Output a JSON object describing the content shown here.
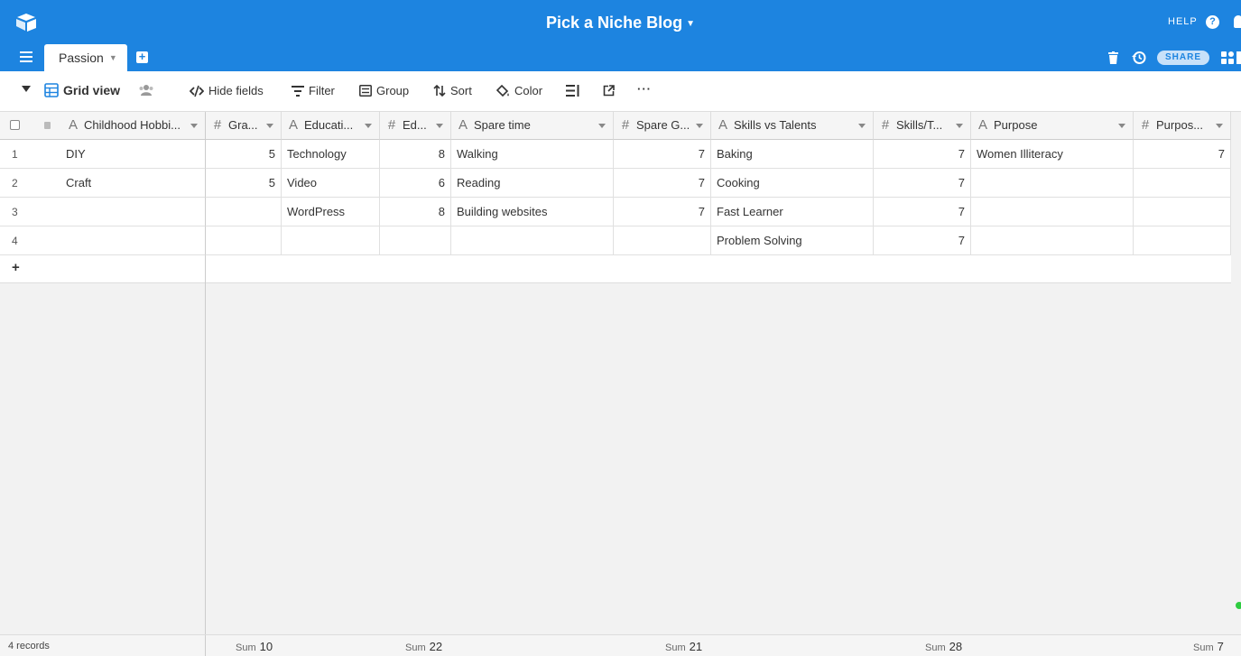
{
  "header": {
    "base_title": "Pick a Niche Blog",
    "help_label": "HELP",
    "share_label": "SHARE",
    "accent_color": "#1d84e0"
  },
  "tabs": [
    {
      "label": "Passion"
    }
  ],
  "toolbar": {
    "view_name": "Grid view",
    "hide_fields": "Hide fields",
    "filter": "Filter",
    "group": "Group",
    "sort": "Sort",
    "color": "Color",
    "more": "···"
  },
  "columns": [
    {
      "label": "Childhood Hobbi...",
      "type": "text"
    },
    {
      "label": "Gra...",
      "type": "number"
    },
    {
      "label": "Educati...",
      "type": "text"
    },
    {
      "label": "Ed...",
      "type": "number"
    },
    {
      "label": "Spare time",
      "type": "text"
    },
    {
      "label": "Spare G...",
      "type": "number"
    },
    {
      "label": "Skills vs Talents",
      "type": "text"
    },
    {
      "label": "Skills/T...",
      "type": "number"
    },
    {
      "label": "Purpose",
      "type": "text"
    },
    {
      "label": "Purpos...",
      "type": "number"
    }
  ],
  "rows": [
    {
      "num": "1",
      "cells": [
        "DIY",
        "5",
        "Technology",
        "8",
        "Walking",
        "7",
        "Baking",
        "7",
        "Women Illiteracy",
        "7"
      ]
    },
    {
      "num": "2",
      "cells": [
        "Craft",
        "5",
        "Video",
        "6",
        "Reading",
        "7",
        "Cooking",
        "7",
        "",
        ""
      ]
    },
    {
      "num": "3",
      "cells": [
        "",
        "",
        "WordPress",
        "8",
        "Building websites",
        "7",
        "Fast Learner",
        "7",
        "",
        ""
      ]
    },
    {
      "num": "4",
      "cells": [
        "",
        "",
        "",
        "",
        "",
        "",
        "Problem Solving",
        "7",
        "",
        ""
      ]
    }
  ],
  "add_row_label": "+",
  "footer": {
    "records": "4 records",
    "sum_label": "Sum",
    "sums": [
      "10",
      "22",
      "21",
      "28",
      "7"
    ]
  }
}
